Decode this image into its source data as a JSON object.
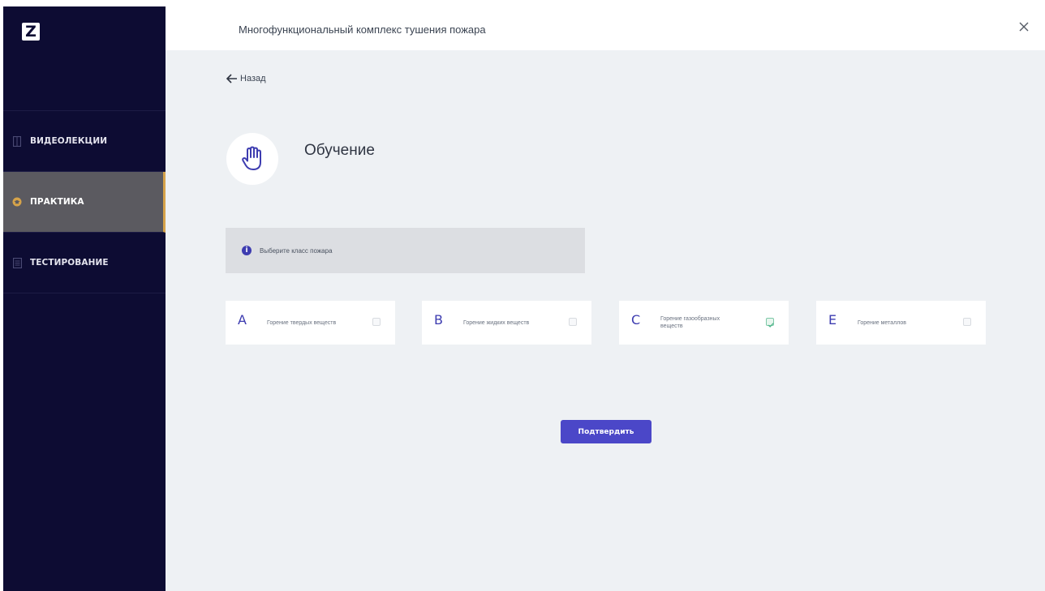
{
  "app": {
    "logo_text": "Z",
    "window_title": "Многофункциональный комплекс тушения пожара",
    "close_icon": "close-icon"
  },
  "sidebar": {
    "items": [
      {
        "label": "ВИДЕОЛЕКЦИИ",
        "icon": "document-icon",
        "active": false
      },
      {
        "label": "ПРАКТИКА",
        "icon": "graduation-cap-icon",
        "active": true
      },
      {
        "label": "ТЕСТИРОВАНИЕ",
        "icon": "list-icon",
        "active": false
      }
    ],
    "background": "#0d0c33",
    "active_background": "#5b5a60",
    "active_accent": "#d6a34a"
  },
  "main": {
    "back_label": "Назад",
    "title": "Обучение",
    "title_icon": "hand-icon",
    "info_text": "Выберите класс пожара",
    "fire_classes": [
      {
        "letter": "A",
        "text": "Горение твердых веществ",
        "checked": false
      },
      {
        "letter": "B",
        "text": "Горение жидких веществ",
        "checked": false
      },
      {
        "letter": "C",
        "text": "Горение газообразных веществ",
        "checked": true
      },
      {
        "letter": "E",
        "text": "Горение металлов",
        "checked": false
      }
    ],
    "confirm_label": "Подтвердить",
    "accent": "#3d3cb0"
  }
}
